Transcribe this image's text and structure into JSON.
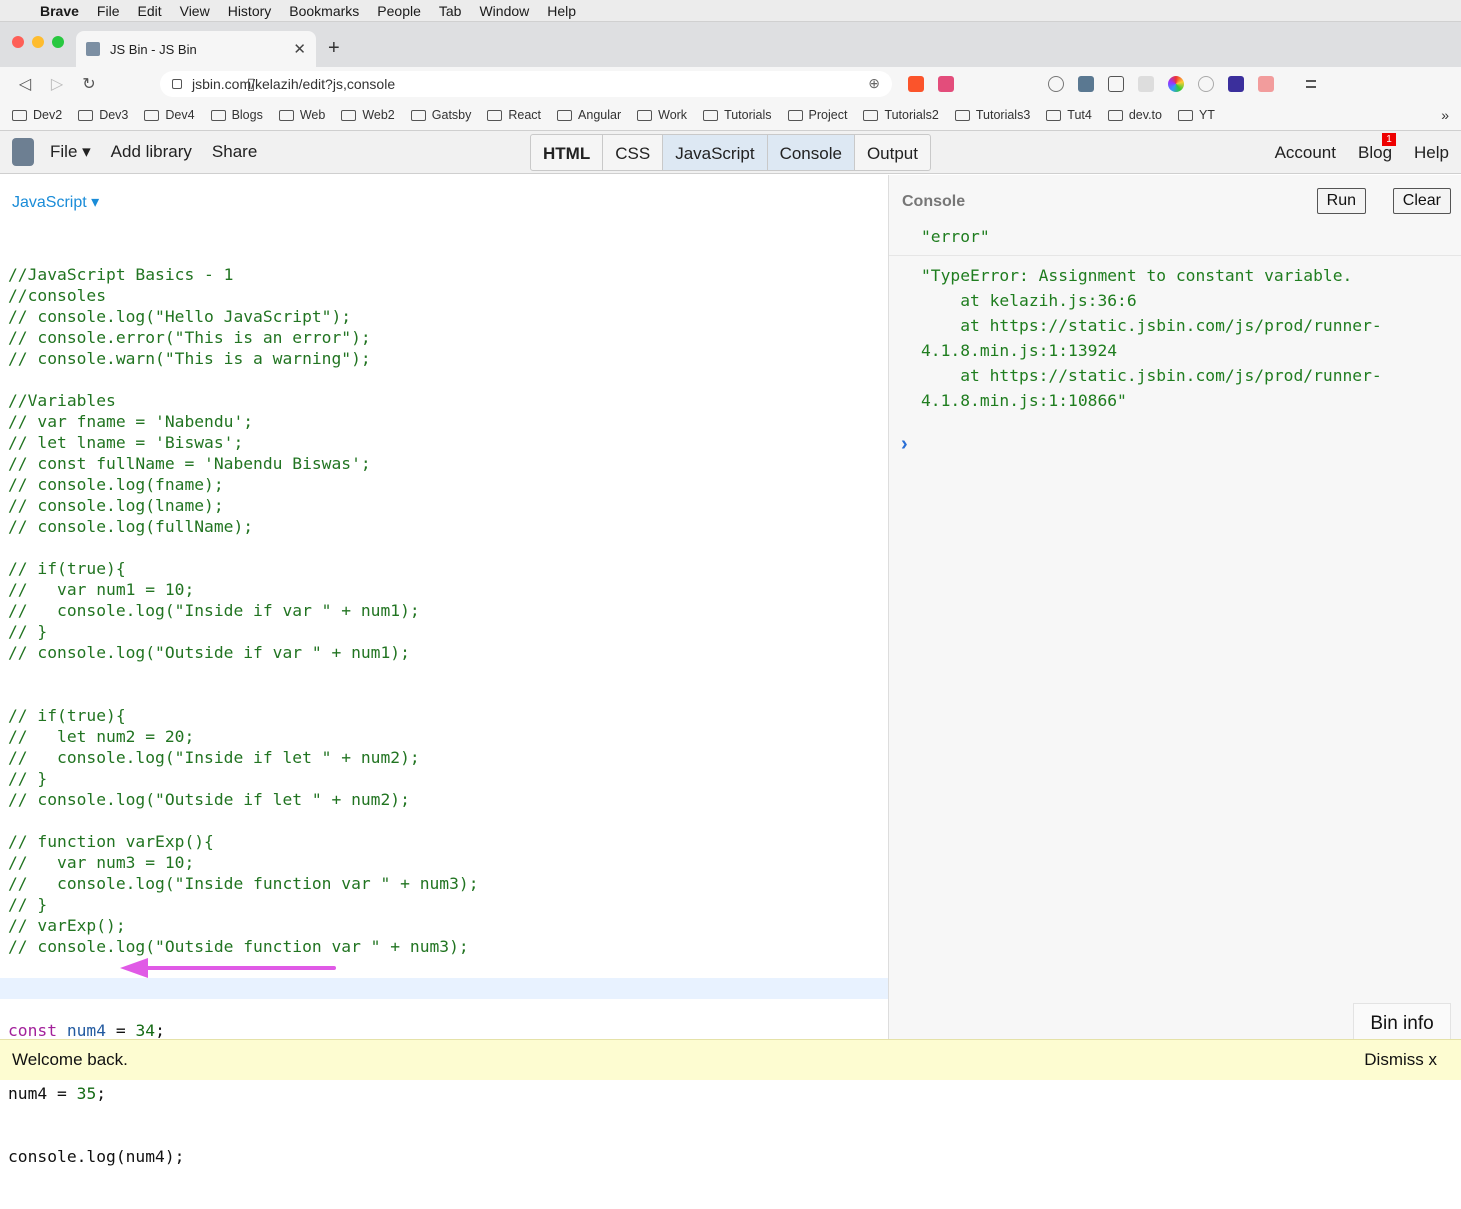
{
  "menubar": {
    "app": "Brave",
    "items": [
      "File",
      "Edit",
      "View",
      "History",
      "Bookmarks",
      "People",
      "Tab",
      "Window",
      "Help"
    ]
  },
  "browser": {
    "tab_title": "JS Bin - JS Bin",
    "url": "jsbin.com/kelazih/edit?js,console",
    "bookmarks": [
      "Dev2",
      "Dev3",
      "Dev4",
      "Blogs",
      "Web",
      "Web2",
      "Gatsby",
      "React",
      "Angular",
      "Work",
      "Tutorials",
      "Project",
      "Tutorials2",
      "Tutorials3",
      "Tut4",
      "dev.to",
      "YT"
    ],
    "bookmarks_more": "»"
  },
  "jsbin": {
    "file_label": "File ▾",
    "add_library": "Add library",
    "share": "Share",
    "panels": [
      "HTML",
      "CSS",
      "JavaScript",
      "Console",
      "Output"
    ],
    "account": "Account",
    "blog": "Blog",
    "blog_badge": "1",
    "help": "Help"
  },
  "editor": {
    "language_label": "JavaScript ▾",
    "lines": [
      "//JavaScript Basics - 1",
      "//consoles",
      "// console.log(\"Hello JavaScript\");",
      "// console.error(\"This is an error\");",
      "// console.warn(\"This is a warning\");",
      "",
      "//Variables",
      "// var fname = 'Nabendu';",
      "// let lname = 'Biswas';",
      "// const fullName = 'Nabendu Biswas';",
      "// console.log(fname);",
      "// console.log(lname);",
      "// console.log(fullName);",
      "",
      "// if(true){",
      "//   var num1 = 10;",
      "//   console.log(\"Inside if var \" + num1);",
      "// }",
      "// console.log(\"Outside if var \" + num1);",
      "",
      "",
      "// if(true){",
      "//   let num2 = 20;",
      "//   console.log(\"Inside if let \" + num2);",
      "// }",
      "// console.log(\"Outside if let \" + num2);",
      "",
      "// function varExp(){",
      "//   var num3 = 10;",
      "//   console.log(\"Inside function var \" + num3);",
      "// }",
      "// varExp();",
      "// console.log(\"Outside function var \" + num3);",
      ""
    ],
    "code_const": "const",
    "code_num4": "num4",
    "code_eq34": " = ",
    "code_34": "34",
    "code_semi": ";",
    "code_line2_a": "num4",
    "code_line2_b": " = ",
    "code_line2_c": "35",
    "code_line2_d": ";",
    "code_line3": "console.log(num4);"
  },
  "console": {
    "label": "Console",
    "run": "Run",
    "clear": "Clear",
    "entry1": "\"error\"",
    "entry2": "\"TypeError: Assignment to constant variable.\n    at kelazih.js:36:6\n    at https://static.jsbin.com/js/prod/runner-\n4.1.8.min.js:1:13924\n    at https://static.jsbin.com/js/prod/runner-\n4.1.8.min.js:1:10866\"",
    "prompt": "›",
    "bin_info": "Bin info"
  },
  "notice": {
    "text": "Welcome back.",
    "dismiss": "Dismiss x"
  },
  "colors": {
    "arrow": "#e05ae6",
    "comment": "#217421",
    "keyword": "#a2209a"
  }
}
